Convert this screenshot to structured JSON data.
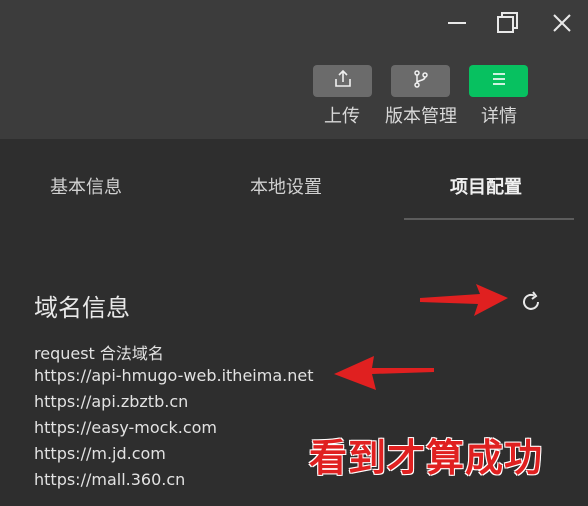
{
  "window_controls": {
    "minimize_icon": "minimize-icon",
    "maximize_icon": "maximize-icon",
    "close_icon": "close-icon"
  },
  "toolbar": {
    "upload": {
      "label": "上传",
      "icon": "upload-icon",
      "color": "#6b6b6b"
    },
    "version": {
      "label": "版本管理",
      "icon": "branch-icon",
      "color": "#6b6b6b"
    },
    "details": {
      "label": "详情",
      "icon": "menu-icon",
      "color": "#07c160"
    }
  },
  "tabs": [
    {
      "label": "基本信息",
      "active": false
    },
    {
      "label": "本地设置",
      "active": false
    },
    {
      "label": "项目配置",
      "active": true
    }
  ],
  "domain_info": {
    "title": "域名信息",
    "refresh_icon": "refresh-icon",
    "request_label": "request 合法域名",
    "domains": [
      "https://api-hmugo-web.itheima.net",
      "https://api.zbztb.cn",
      "https://easy-mock.com",
      "https://m.jd.com",
      "https://mall.360.cn"
    ]
  },
  "annotation": {
    "text": "看到才算成功",
    "color": "#e02020"
  }
}
